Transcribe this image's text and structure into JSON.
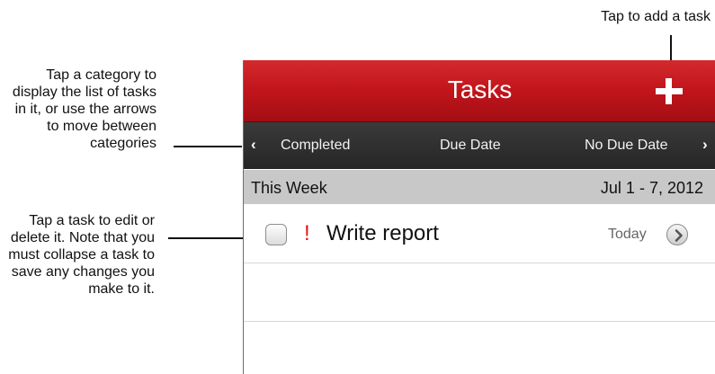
{
  "callouts": {
    "add_task": "Tap to add a task",
    "category": "Tap a category to display the list of tasks in it, or use the arrows to move between categories",
    "task": "Tap a task to edit or delete it. Note that you must collapse a task to save any changes you make to it."
  },
  "navbar": {
    "title": "Tasks",
    "add_icon": "plus-icon",
    "color": "#c1151b"
  },
  "categories": {
    "left_arrow": "‹",
    "right_arrow": "›",
    "items": [
      "Completed",
      "Due Date",
      "No Due Date"
    ]
  },
  "section": {
    "title": "This Week",
    "dates": "Jul 1 - 7, 2012"
  },
  "tasks": [
    {
      "priority": "!",
      "title": "Write report",
      "due": "Today",
      "checked": false,
      "priority_color": "#e0141e"
    }
  ]
}
